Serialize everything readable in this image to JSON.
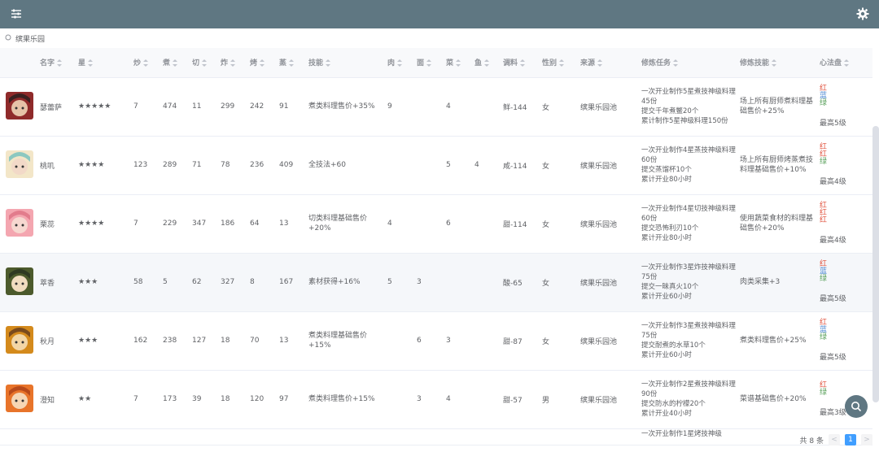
{
  "filter": {
    "tag": "缤果乐园"
  },
  "headers": [
    "名字",
    "星",
    "炒",
    "煮",
    "切",
    "炸",
    "烤",
    "蒸",
    "技能",
    "肉",
    "面",
    "菜",
    "鱼",
    "调料",
    "性别",
    "来源",
    "修炼任务",
    "修炼技能",
    "心法盘"
  ],
  "rows": [
    {
      "name": "瑟蕾萨",
      "stars": "★★★★★",
      "chao": "7",
      "zhu": "474",
      "qie": "11",
      "zha": "299",
      "kao": "242",
      "zheng": "91",
      "skill": "煮类料理售价+35%",
      "rou": "9",
      "mian": "",
      "cai": "4",
      "yu": "",
      "tiaoliao": "鲜-144",
      "gender": "女",
      "source": "缤果乐园池",
      "task": "一次开业制作5星煮技神级料理45份\n提交千年煮鳖20个\n累计制作5星神级料理150份",
      "train_skill": "场上所有厨师煮料理基础售价+25%",
      "xf": [
        "红",
        "蓝",
        "绿"
      ],
      "xf_max": "最高5级",
      "av": [
        "#8f2a2a",
        "#e6c3a8",
        "#3a2020"
      ]
    },
    {
      "name": "桃叽",
      "stars": "★★★★",
      "chao": "123",
      "zhu": "289",
      "qie": "71",
      "zha": "78",
      "kao": "236",
      "zheng": "409",
      "skill": "全技法+60",
      "rou": "",
      "mian": "",
      "cai": "5",
      "yu": "4",
      "tiaoliao": "咸-114",
      "gender": "女",
      "source": "缤果乐园池",
      "task": "一次开业制作4星蒸技神级料理60份\n提交蒸馏杯10个\n累计开业80小时",
      "train_skill": "场上所有厨师烤蒸煮技料理基础售价+10%",
      "xf": [
        "红",
        "红",
        "绿"
      ],
      "xf_max": "最高4级",
      "av": [
        "#f3e6c8",
        "#f2d9c8",
        "#8cc8c0"
      ]
    },
    {
      "name": "栗蕊",
      "stars": "★★★★",
      "chao": "7",
      "zhu": "229",
      "qie": "347",
      "zha": "186",
      "kao": "64",
      "zheng": "13",
      "skill": "切类料理基础售价+20%",
      "rou": "4",
      "mian": "",
      "cai": "6",
      "yu": "",
      "tiaoliao": "甜-114",
      "gender": "女",
      "source": "缤果乐园池",
      "task": "一次开业制作4星切技神级料理60份\n提交恐怖利刃10个\n累计开业80小时",
      "train_skill": "使用蔬菜食材的料理基础售价+20%",
      "xf": [
        "红",
        "红",
        "红"
      ],
      "xf_max": "最高4级",
      "av": [
        "#f4a6b0",
        "#f6d8d0",
        "#e27c8c"
      ]
    },
    {
      "name": "萃香",
      "stars": "★★★",
      "chao": "58",
      "zhu": "5",
      "qie": "62",
      "zha": "327",
      "kao": "8",
      "zheng": "167",
      "skill": "素材获得+16%",
      "rou": "5",
      "mian": "3",
      "cai": "",
      "yu": "",
      "tiaoliao": "酸-65",
      "gender": "女",
      "source": "缤果乐园池",
      "task": "一次开业制作3星炸技神级料理75份\n提交一昧真火10个\n累计开业60小时",
      "train_skill": "肉类采集+3",
      "xf": [
        "红",
        "蓝",
        "绿"
      ],
      "xf_max": "最高5级",
      "av": [
        "#4c5a2c",
        "#f1dcc0",
        "#2f3a22"
      ]
    },
    {
      "name": "秋月",
      "stars": "★★★",
      "chao": "162",
      "zhu": "238",
      "qie": "127",
      "zha": "18",
      "kao": "70",
      "zheng": "13",
      "skill": "煮类料理基础售价+15%",
      "rou": "",
      "mian": "6",
      "cai": "3",
      "yu": "",
      "tiaoliao": "甜-87",
      "gender": "女",
      "source": "缤果乐园池",
      "task": "一次开业制作3星煮技神级料理75份\n提交耐煮的水草10个\n累计开业60小时",
      "train_skill": "煮类料理售价+25%",
      "xf": [
        "红",
        "蓝",
        "绿"
      ],
      "xf_max": "最高5级",
      "av": [
        "#d48a1c",
        "#f3d6a6",
        "#7a4a1c"
      ]
    },
    {
      "name": "澄知",
      "stars": "★★",
      "chao": "7",
      "zhu": "173",
      "qie": "39",
      "zha": "18",
      "kao": "120",
      "zheng": "97",
      "skill": "煮类料理售价+15%",
      "rou": "",
      "mian": "3",
      "cai": "4",
      "yu": "",
      "tiaoliao": "甜-57",
      "gender": "男",
      "source": "缤果乐园池",
      "task": "一次开业制作2星煮技神级料理90份\n提交防水的柠檬20个\n累计开业40小时",
      "train_skill": "菜谱基础售价+20%",
      "xf": [
        "红",
        "绿"
      ],
      "xf_max": "最高3级",
      "av": [
        "#e8742a",
        "#f6d6b4",
        "#b84a1a"
      ]
    }
  ],
  "partial_row_task": "一次开业制作1星烤技神级",
  "pager": {
    "total": "共 8 条",
    "page": "1",
    "prev": "<",
    "next": ">"
  }
}
